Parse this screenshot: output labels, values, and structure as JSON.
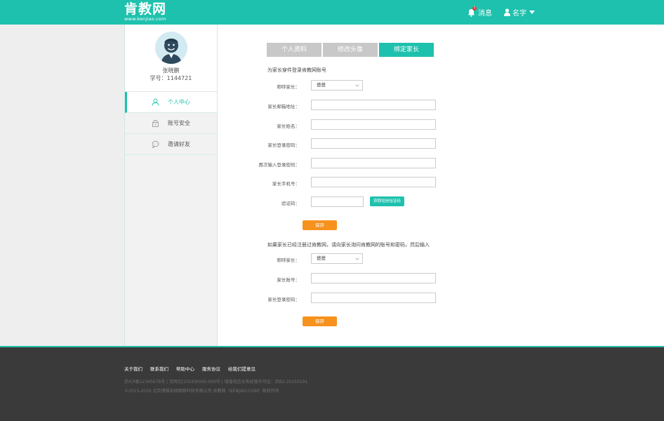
{
  "header": {
    "logo_text": "肯教网",
    "logo_url": "www.kenjiao.com",
    "messages_label": "消息",
    "messages_count": "1",
    "user_label": "名字"
  },
  "sidebar": {
    "profile_name": "张晓鹏",
    "profile_id": "学号：1144721",
    "items": [
      {
        "label": "个人中心",
        "icon": "person-icon"
      },
      {
        "label": "账号安全",
        "icon": "lock-icon"
      },
      {
        "label": "邀请好友",
        "icon": "chat-icon"
      }
    ]
  },
  "tabs": [
    {
      "label": "个人资料"
    },
    {
      "label": "修改头像"
    },
    {
      "label": "绑定家长"
    }
  ],
  "form1": {
    "note": "为家长穿件登录肯教网账号",
    "title_label": "称呼家长：",
    "title_value": "爸爸",
    "email_label": "家长邮箱地址：",
    "name_label": "家长姓名：",
    "password_label": "家长登录密码：",
    "password2_label": "再次输入登录密码：",
    "phone_label": "家长手机号：",
    "code_label": "验证码：",
    "code_button": "获取短信验证码",
    "save_button": "保存"
  },
  "form2": {
    "note": "如果家长已经注册过肯教网，请向家长询问肯教网的账号和密码，然后输入",
    "title_label": "称呼家长：",
    "title_value": "爸爸",
    "account_label": "家长账号：",
    "password_label": "家长登录密码：",
    "save_button": "保存"
  },
  "footer": {
    "links": [
      "关于我们",
      "联系我们",
      "帮助中心",
      "服务协议",
      "给我们提意见"
    ],
    "icp": "京ICP备12345678号 | 京网文[2016]0000-000号 | 增值电信业务经营许可证：京B2-20150191",
    "copyright": "©2015-2016 北京博雅肯翔网络科技有限公司  肯教网（KENJIAO.COM）版权所有"
  },
  "colors": {
    "brand": "#1ec1ad",
    "save": "#f7921e",
    "footer": "#3a3a3a"
  }
}
